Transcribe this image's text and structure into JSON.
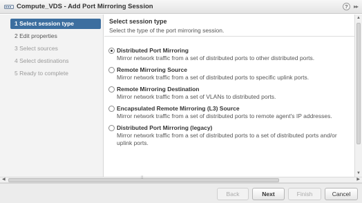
{
  "window": {
    "title": "Compute_VDS - Add Port Mirroring Session",
    "help_glyph": "?",
    "expand_glyph": "▸▸"
  },
  "steps": [
    {
      "label": "1  Select session type",
      "state": "active"
    },
    {
      "label": "2  Edit properties",
      "state": "enabled"
    },
    {
      "label": "3  Select sources",
      "state": "disabled"
    },
    {
      "label": "4  Select destinations",
      "state": "disabled"
    },
    {
      "label": "5  Ready to complete",
      "state": "disabled"
    }
  ],
  "content": {
    "title": "Select session type",
    "description": "Select the type of the port mirroring session.",
    "options": [
      {
        "label": "Distributed Port Mirroring",
        "description": "Mirror network traffic from a set of distributed ports to other distributed ports.",
        "selected": true
      },
      {
        "label": "Remote Mirroring Source",
        "description": "Mirror network traffic from a set of distributed ports to specific uplink ports.",
        "selected": false
      },
      {
        "label": "Remote Mirroring Destination",
        "description": "Mirror network traffic from a set of VLANs to distributed ports.",
        "selected": false
      },
      {
        "label": "Encapsulated Remote Mirroring (L3) Source",
        "description": "Mirror network traffic from a set of distributed ports to remote agent's IP addresses.",
        "selected": false
      },
      {
        "label": "Distributed Port Mirroring (legacy)",
        "description": "Mirror network traffic from a set of distributed ports to a set of distributed ports and/or uplink ports.",
        "selected": false
      }
    ]
  },
  "scroll": {
    "up": "▲",
    "down": "▼",
    "left": "◀",
    "right": "▶",
    "grip": "⁞⁞"
  },
  "buttons": {
    "back": "Back",
    "next": "Next",
    "finish": "Finish",
    "cancel": "Cancel"
  },
  "colors": {
    "active_step": "#3c6e9f",
    "sidebar_bg": "#f3f3f3",
    "footer_bg": "#ececec"
  },
  "icons": {
    "title": "switch-icon"
  }
}
